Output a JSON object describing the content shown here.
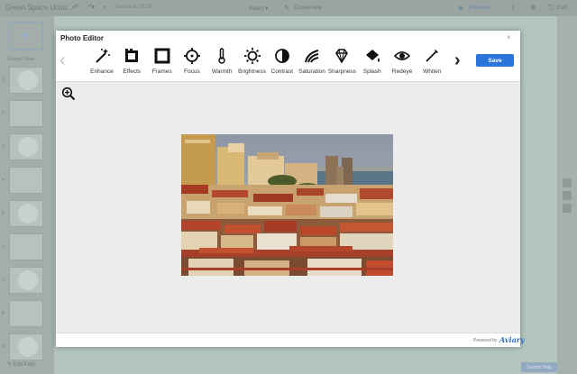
{
  "app": {
    "title": "Green Space Unito...",
    "saved_status": "Saved at 10:52",
    "insert_label": "Insert",
    "customize_label": "Customize",
    "preview_label": "Preview",
    "exit_label": "Exit",
    "start_label": "Started Flows",
    "slide_numbers": [
      "1",
      "2",
      "3",
      "4",
      "5",
      "6",
      "7",
      "8",
      "9"
    ],
    "edit_path_label": "Edit Path",
    "bottom_button_label": "Search Help"
  },
  "editor": {
    "title": "Photo Editor",
    "close_symbol": "×",
    "prev_symbol": "‹",
    "next_symbol": "›",
    "save_label": "Save",
    "tools": [
      {
        "label": "Enhance",
        "icon": "magic-wand-icon"
      },
      {
        "label": "Effects",
        "icon": "film-icon"
      },
      {
        "label": "Frames",
        "icon": "frame-icon"
      },
      {
        "label": "Focus",
        "icon": "crosshair-icon"
      },
      {
        "label": "Warmth",
        "icon": "thermometer-icon"
      },
      {
        "label": "Brightness",
        "icon": "sun-icon"
      },
      {
        "label": "Contrast",
        "icon": "contrast-icon"
      },
      {
        "label": "Saturation",
        "icon": "saturation-icon"
      },
      {
        "label": "Sharpness",
        "icon": "diamond-icon"
      },
      {
        "label": "Splash",
        "icon": "splash-icon"
      },
      {
        "label": "Redeye",
        "icon": "eye-icon"
      },
      {
        "label": "Whiten",
        "icon": "brush-icon"
      }
    ],
    "footer": {
      "powered_by": "Powered by",
      "brand": "Aviary"
    }
  }
}
